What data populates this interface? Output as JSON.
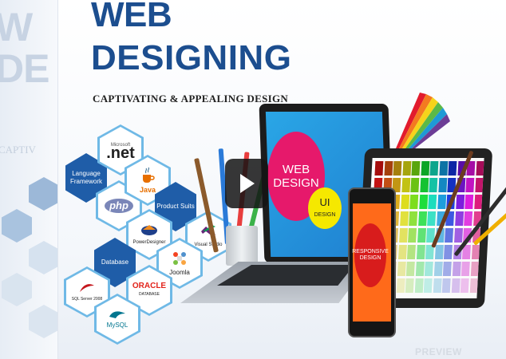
{
  "banner": {
    "title_line1": "WEB",
    "title_line2": "DESIGNING",
    "tagline": "CAPTIVATING & APPEALING DESIGN"
  },
  "ghost_text": {
    "title": "W\nDE",
    "caption": "CAPTIV"
  },
  "hexagons": {
    "microsoft": "Microsoft",
    "net": ".net",
    "language": "Language Framework",
    "php": "php",
    "java": "Java",
    "product": "Product Suits",
    "powerdesigner": "PowerDesigner",
    "visualstudio": "Visual Studio",
    "database": "Database",
    "joomla": "Joomla",
    "oracle": "ORACLE",
    "oracle_sub": "DATABASE",
    "sqlserver": "SQL Server 2008",
    "mysql": "MySQL"
  },
  "devices": {
    "laptop_circle_line1": "WEB",
    "laptop_circle_line2": "DESIGN",
    "ui_line1": "UI",
    "ui_line2": "DESIGN",
    "phone_circle": "RESPONSIVE DESIGN"
  },
  "video": {
    "play_label": "Play video"
  },
  "watermark": "PREVIEW",
  "colors": {
    "title_blue": "#1c4e8f",
    "hex_blue": "#1f5da8",
    "web_pink": "#e6196b",
    "ui_yellow": "#f5e800",
    "phone_orange": "#ff6a1a"
  }
}
